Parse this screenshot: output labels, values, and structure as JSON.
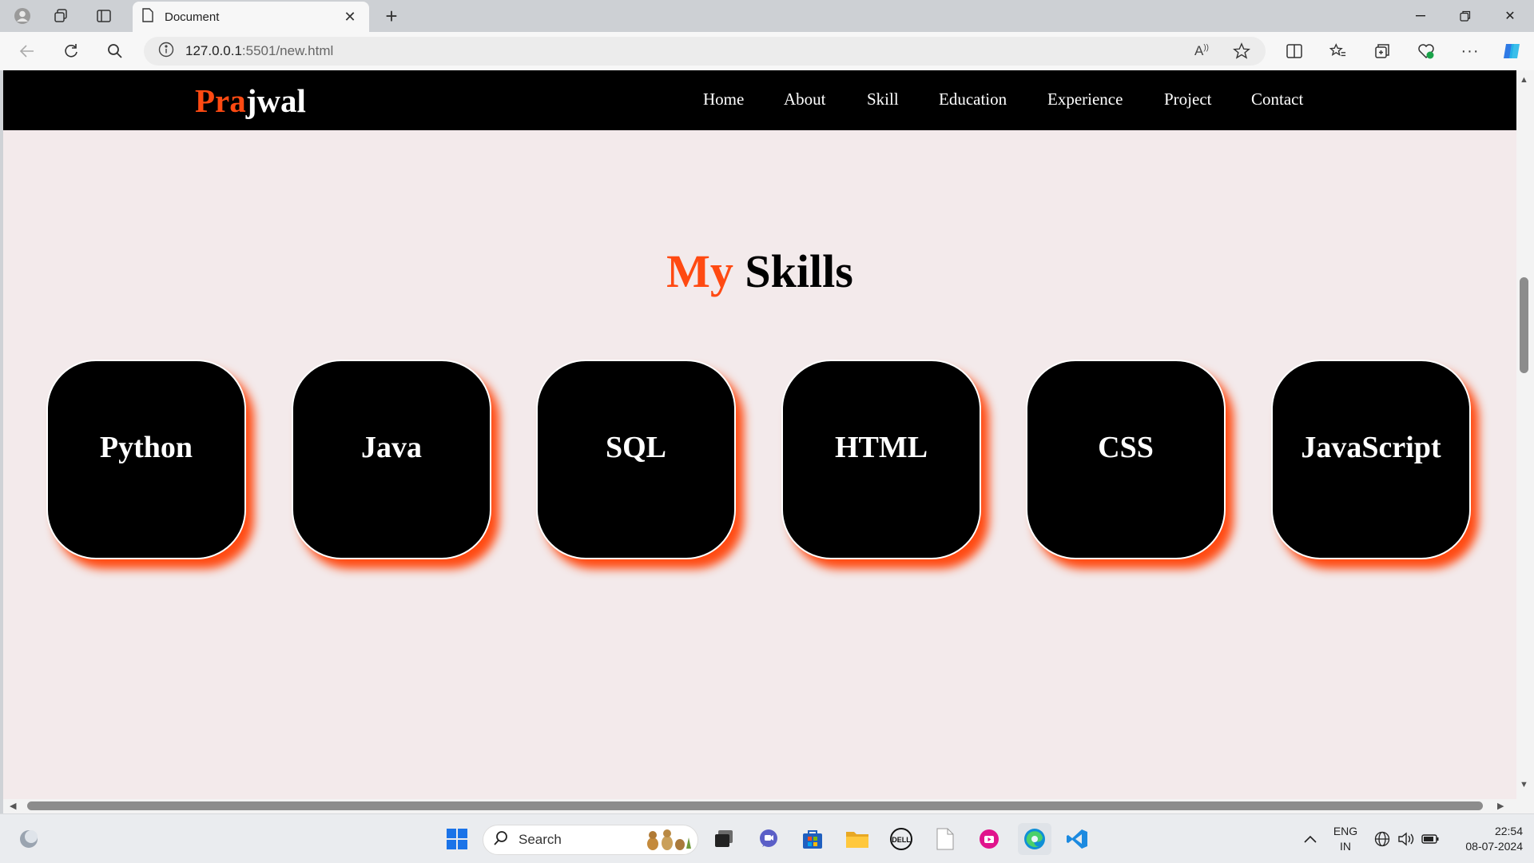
{
  "browser": {
    "tab_title": "Document",
    "url_host": "127.0.0.1",
    "url_rest": ":5501/new.html"
  },
  "site": {
    "logo_accent": "Pra",
    "logo_rest": "jwal",
    "nav": [
      "Home",
      "About",
      "Skill",
      "Education",
      "Experience",
      "Project",
      "Contact"
    ],
    "heading_accent": "My",
    "heading_rest": "Skills",
    "skills": [
      "Python",
      "Java",
      "SQL",
      "HTML",
      "CSS",
      "JavaScript"
    ],
    "accent_color": "#ff4a12"
  },
  "taskbar": {
    "search_placeholder": "Search",
    "lang_line1": "ENG",
    "lang_line2": "IN",
    "time": "22:54",
    "date": "08-07-2024"
  }
}
